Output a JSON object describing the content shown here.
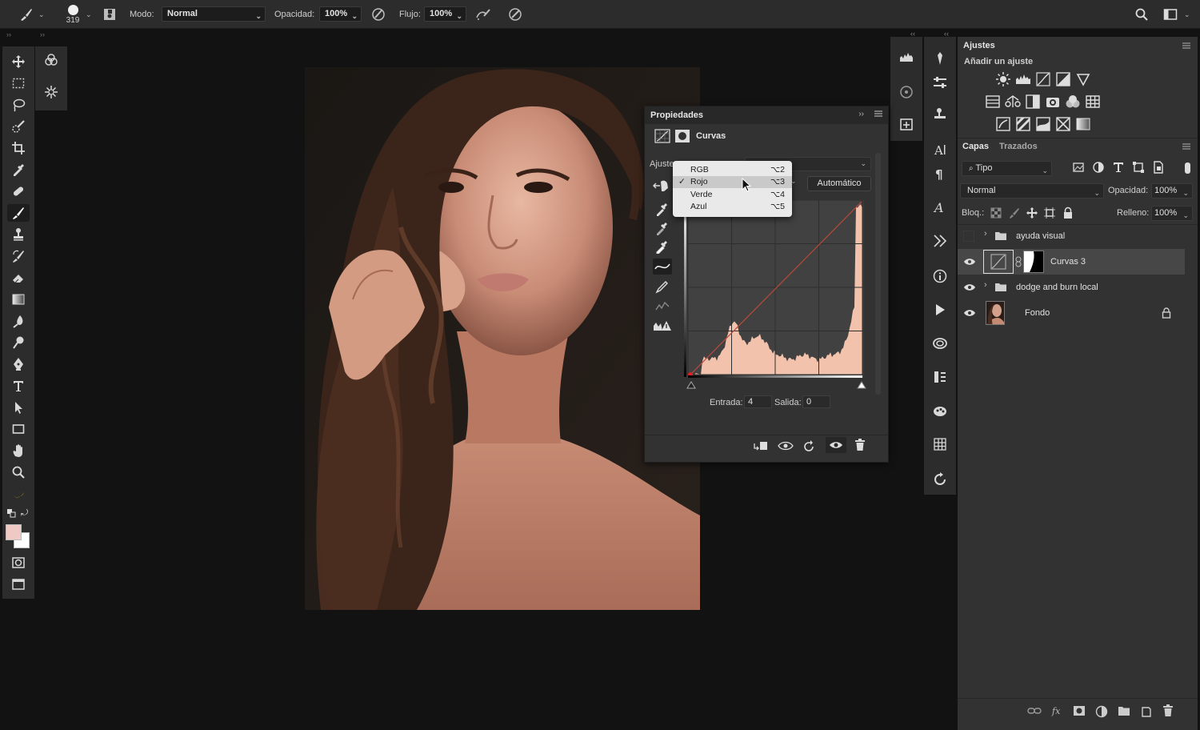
{
  "options_bar": {
    "brush_size": "319",
    "mode_label": "Modo:",
    "mode_value": "Normal",
    "opacity_label": "Opacidad:",
    "opacity_value": "100%",
    "flow_label": "Flujo:",
    "flow_value": "100%"
  },
  "properties": {
    "title": "Propiedades",
    "section": "Curvas",
    "preset_label": "Ajuste",
    "auto_button": "Automático",
    "input_label": "Entrada:",
    "input_value": "4",
    "output_label": "Salida:",
    "output_value": "0",
    "curve_color": "#b84a3a",
    "histogram_color": "#f3c2ad"
  },
  "channel_menu": {
    "items": [
      {
        "label": "RGB",
        "shortcut": "⌥2",
        "checked": false
      },
      {
        "label": "Rojo",
        "shortcut": "⌥3",
        "checked": true
      },
      {
        "label": "Verde",
        "shortcut": "⌥4",
        "checked": false
      },
      {
        "label": "Azul",
        "shortcut": "⌥5",
        "checked": false
      }
    ]
  },
  "adjustments": {
    "title": "Ajustes",
    "subtitle": "Añadir un ajuste"
  },
  "layers_panel": {
    "tabs": [
      "Capas",
      "Trazados"
    ],
    "filter_label": "Tipo",
    "blend_mode": "Normal",
    "opacity_label": "Opacidad:",
    "opacity_value": "100%",
    "lock_label": "Bloq.:",
    "fill_label": "Relleno:",
    "fill_value": "100%",
    "layers": [
      {
        "name": "ayuda visual",
        "type": "group",
        "visible": false
      },
      {
        "name": "Curvas 3",
        "type": "adjustment",
        "visible": true,
        "selected": true
      },
      {
        "name": "dodge and burn local",
        "type": "group",
        "visible": true
      },
      {
        "name": "Fondo",
        "type": "image",
        "visible": true,
        "locked": true
      }
    ]
  },
  "colors": {
    "foreground": "#efc9c4",
    "background": "#ffffff"
  }
}
